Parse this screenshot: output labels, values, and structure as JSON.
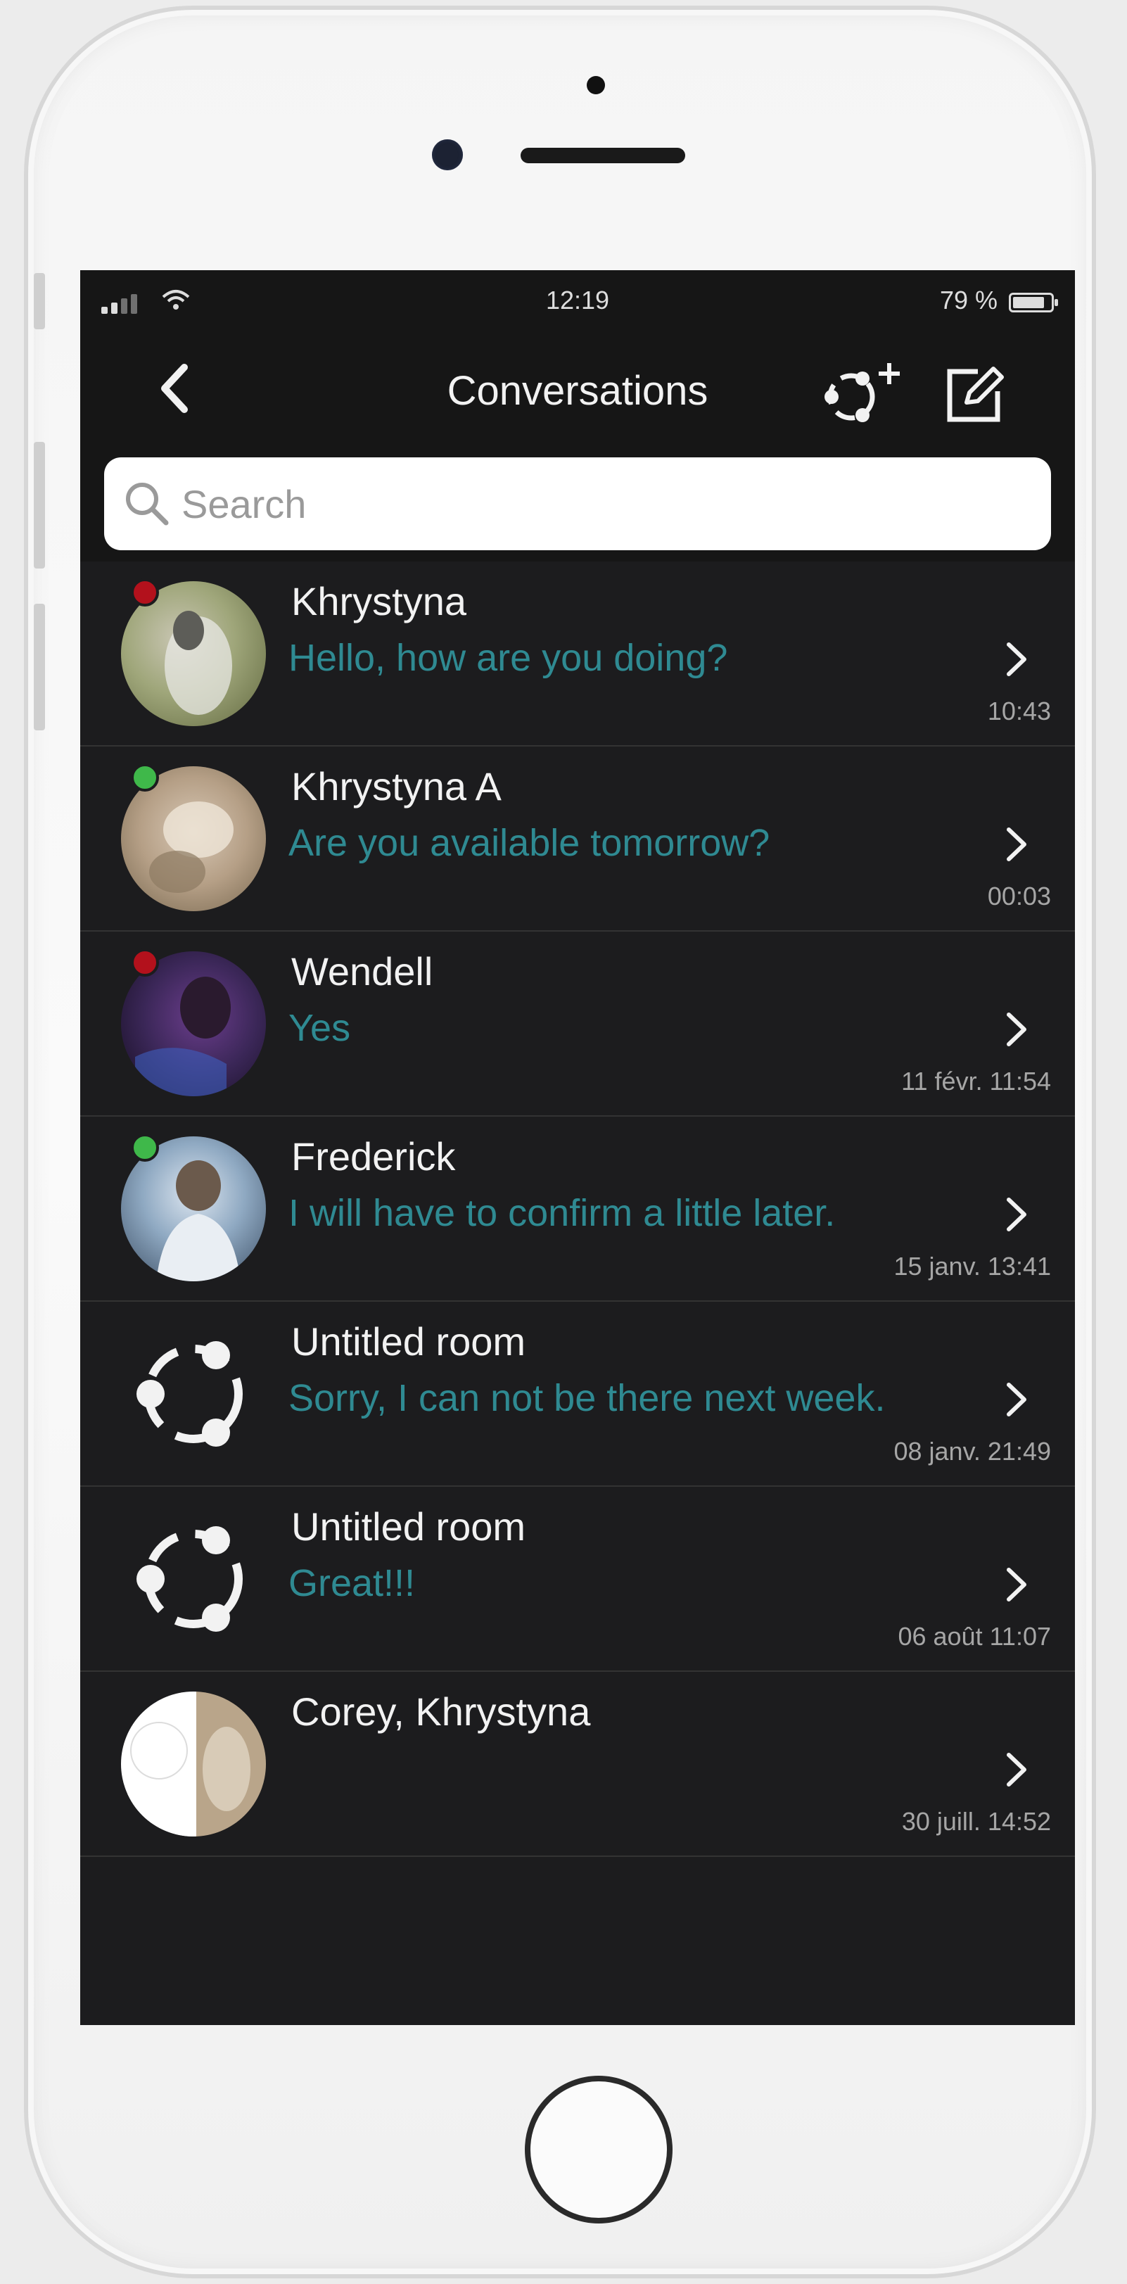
{
  "status_bar": {
    "time": "12:19",
    "battery": "79 %"
  },
  "nav": {
    "title": "Conversations"
  },
  "search": {
    "placeholder": "Search"
  },
  "conversations": [
    {
      "name": "Khrystyna",
      "preview": "Hello, how are you doing?",
      "time": "10:43",
      "presence": "busy",
      "avatar": "photo"
    },
    {
      "name": "Khrystyna A",
      "preview": "Are you available tomorrow?",
      "time": "00:03",
      "presence": "online",
      "avatar": "photo"
    },
    {
      "name": "Wendell",
      "preview": "Yes",
      "time": "11 févr. 11:54",
      "presence": "busy",
      "avatar": "photo"
    },
    {
      "name": "Frederick",
      "preview": "I will have to confirm a little later.",
      "time": "15 janv. 13:41",
      "presence": "online",
      "avatar": "photo"
    },
    {
      "name": "Untitled room",
      "preview": "Sorry, I can not be there next week.",
      "time": "08 janv. 21:49",
      "presence": "none",
      "avatar": "room-icon"
    },
    {
      "name": "Untitled room",
      "preview": "Great!!!",
      "time": "06 août 11:07",
      "presence": "none",
      "avatar": "room-icon"
    },
    {
      "name": "Corey, Khrystyna",
      "preview": "",
      "time": "30 juill. 14:52",
      "presence": "none",
      "avatar": "group-photo"
    }
  ],
  "colors": {
    "background": "#1c1c1e",
    "preview_text": "#2f8a92",
    "presence_busy": "#b3111c",
    "presence_online": "#3fb84a"
  }
}
